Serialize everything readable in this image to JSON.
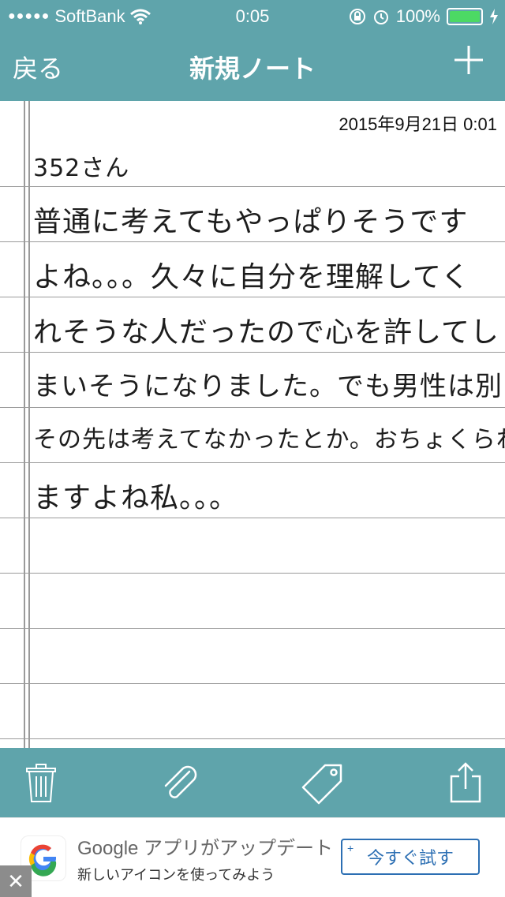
{
  "status_bar": {
    "carrier": "SoftBank",
    "time": "0:05",
    "battery": "100%",
    "signal_icon": "signal-dots-icon",
    "wifi_icon": "wifi-icon",
    "lock_icon": "rotation-lock-icon",
    "alarm_icon": "alarm-icon",
    "charging_icon": "charging-bolt-icon"
  },
  "nav": {
    "back_label": "戻る",
    "title": "新規ノート",
    "add_icon": "plus-icon"
  },
  "note": {
    "date": "2015年9月21日 0:01",
    "lines": [
      "352さん",
      "普通に考えてもやっぱりそうです",
      "よね。。。久々に自分を理解してく",
      "れそうな人だったので心を許してし",
      "まいそうになりました。でも男性は別に",
      "その先は考えてなかったとか。おちょくられて",
      "ますよね私。。。"
    ]
  },
  "toolbar": {
    "icons": [
      "trash-icon",
      "paperclip-icon",
      "tag-icon",
      "share-icon"
    ]
  },
  "ad": {
    "title": "Google アプリがアップデート",
    "subtitle": "新しいアイコンを使ってみよう",
    "button_label": "今すぐ試す",
    "button_plus": "+",
    "close_label": "✕"
  },
  "colors": {
    "accent": "#5fa4ab",
    "ad_button": "#2c6fb3",
    "battery_fill": "#4cd964"
  }
}
